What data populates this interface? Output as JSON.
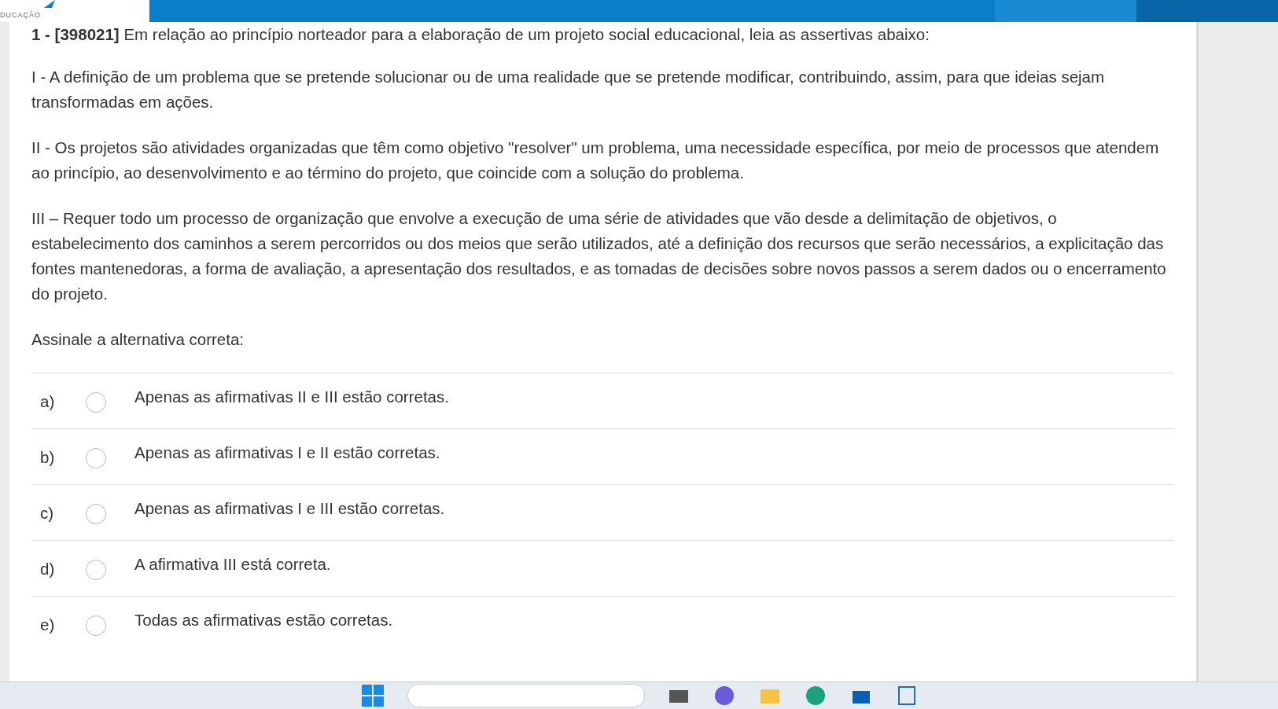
{
  "header": {
    "logo_text": "DUCAÇÃO"
  },
  "question": {
    "number": "1 - [398021]",
    "prompt": "Em relação ao princípio norteador para a elaboração de um projeto social educacional, leia as assertivas abaixo:",
    "statements": [
      "I -  A definição de um problema que se pretende solucionar ou de uma realidade que se pretende modificar, contribuindo, assim, para que ideias sejam transformadas em ações.",
      "II -  Os projetos são atividades organizadas que têm como objetivo \"resolver\" um problema, uma necessidade específica, por meio de processos que atendem ao princípio, ao desenvolvimento e ao término do projeto, que coincide com a solução do problema.",
      "III – Requer todo um processo de organização que envolve a execução de uma série de atividades que vão desde a delimitação de objetivos, o estabelecimento dos caminhos a serem percorridos ou dos meios que serão utilizados, até a definição dos recursos que serão necessários, a explicitação das fontes mantenedoras, a forma de avaliação, a apresentação dos resultados, e as tomadas de decisões sobre novos passos a serem dados ou o encerramento do projeto."
    ],
    "instruction": "Assinale a alternativa correta:",
    "options": [
      {
        "letter": "a)",
        "text": "Apenas as afirmativas II e III estão corretas.",
        "selected": false
      },
      {
        "letter": "b)",
        "text": "Apenas as afirmativas I e II  estão corretas.",
        "selected": false
      },
      {
        "letter": "c)",
        "text": "Apenas as afirmativas I e III estão corretas.",
        "selected": false
      },
      {
        "letter": "d)",
        "text": "A afirmativa III está correta.",
        "selected": false
      },
      {
        "letter": "e)",
        "text": "Todas as afirmativas estão corretas.",
        "selected": false
      }
    ]
  }
}
